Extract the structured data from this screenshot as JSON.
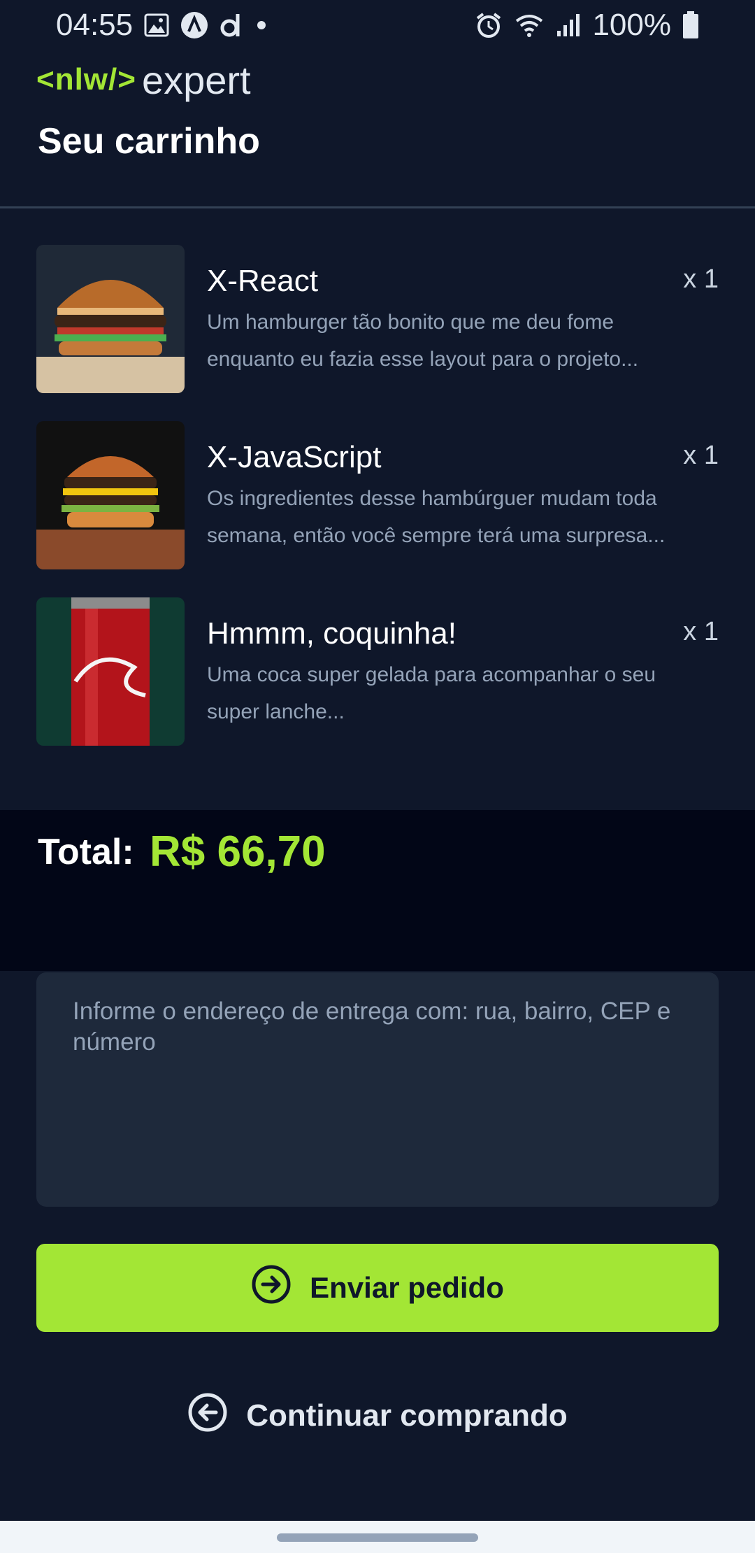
{
  "status_bar": {
    "time": "04:55",
    "battery": "100%",
    "left_icons": [
      "gallery-icon",
      "app-a-icon",
      "app-d-icon",
      "dot-icon"
    ],
    "right_icons": [
      "alarm-icon",
      "wifi-icon",
      "signal-icon",
      "battery-icon"
    ]
  },
  "header": {
    "logo_left": "<nlw/>",
    "logo_right": "expert",
    "title": "Seu carrinho"
  },
  "cart": {
    "items": [
      {
        "name": "X-React",
        "qty": "x 1",
        "description": "Um hamburger tão bonito que me deu fome enquanto eu fazia esse layout para o projeto...",
        "image": "burger-photo"
      },
      {
        "name": "X-JavaScript",
        "qty": "x 1",
        "description": "Os ingredientes desse hambúrguer mudam toda semana, então você sempre terá uma surpresa...",
        "image": "cheeseburger-photo"
      },
      {
        "name": "Hmmm, coquinha!",
        "qty": "x 1",
        "description": "Uma coca super gelada para acompanhar o seu super lanche...",
        "image": "coca-cola-can-photo"
      }
    ]
  },
  "total": {
    "label": "Total:",
    "value": "R$ 66,70"
  },
  "address": {
    "value": "",
    "placeholder": "Informe o endereço de entrega com: rua, bairro, CEP e número"
  },
  "actions": {
    "send_label": "Enviar pedido",
    "continue_label": "Continuar comprando"
  },
  "colors": {
    "background": "#0f172a",
    "accent": "#a3e635",
    "input_bg": "#1e293b",
    "total_band": "#020617"
  }
}
